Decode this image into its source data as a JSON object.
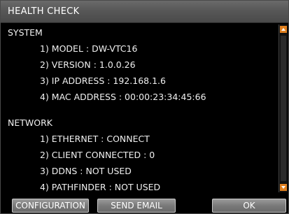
{
  "title": "HEALTH CHECK",
  "system": {
    "heading": "SYSTEM",
    "items": [
      "1) MODEL : DW-VTC16",
      "2) VERSION : 1.0.0.26",
      "3) IP ADDRESS : 192.168.1.6",
      "4) MAC ADDRESS : 00:00:23:34:45:66"
    ]
  },
  "network": {
    "heading": "NETWORK",
    "items": [
      "1) ETHERNET : CONNECT",
      "2) CLIENT CONNECTED : 0",
      "3) DDNS : NOT USED",
      "4) PATHFINDER : NOT USED"
    ]
  },
  "buttons": {
    "configuration": "CONFIGURATION",
    "send_email": "SEND EMAIL",
    "ok": "OK"
  },
  "colors": {
    "background": "#000000",
    "titlebar": "#5a5a5a",
    "scroll_arrow": "#e0801f",
    "text": "#f0f0f0"
  },
  "icons": {
    "scroll_up": "scroll-up-arrow-icon",
    "scroll_down": "scroll-down-arrow-icon"
  }
}
